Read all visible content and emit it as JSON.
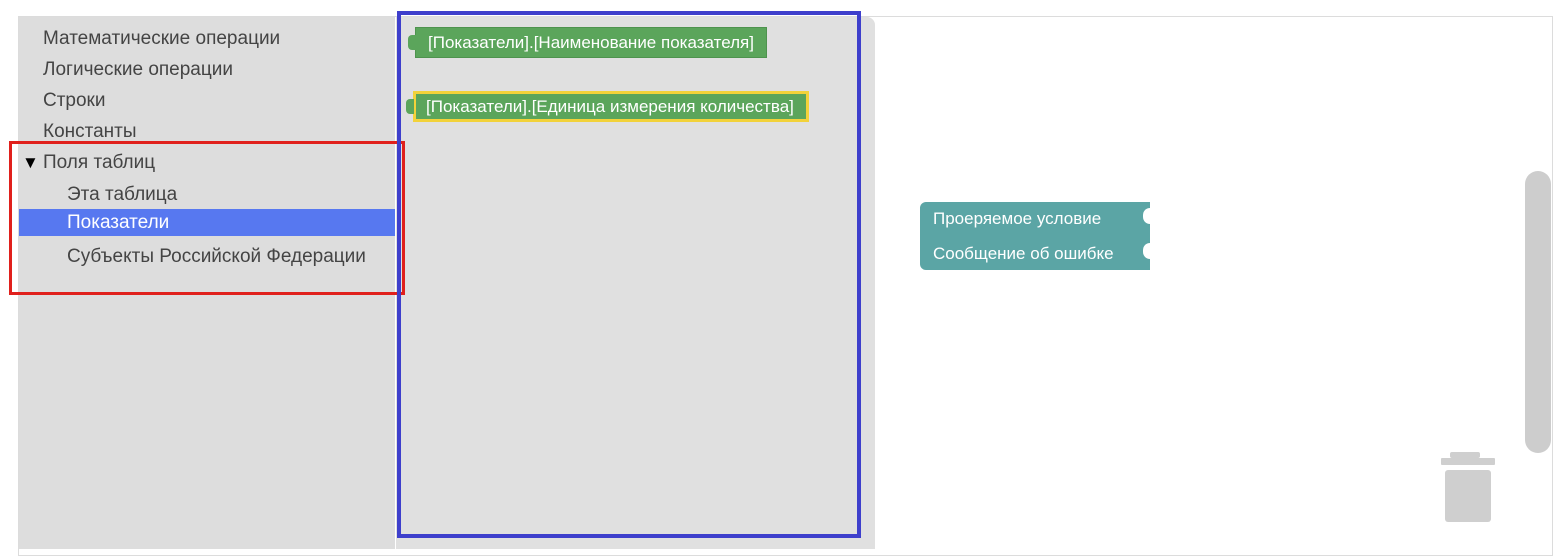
{
  "toolbox": {
    "items": [
      {
        "label": "Математические операции"
      },
      {
        "label": "Логические операции"
      },
      {
        "label": "Строки"
      },
      {
        "label": "Константы"
      },
      {
        "label": "Поля таблиц",
        "expanded_marker": "▼"
      },
      {
        "label": "Эта таблица"
      },
      {
        "label": "Показатели",
        "selected": true
      },
      {
        "label": "Субъекты Российской Федерации"
      }
    ]
  },
  "flyout": {
    "blocks": [
      {
        "label": "[Показатели].[Наименование показателя]",
        "color": "#5ba55b"
      },
      {
        "label": "[Показатели].[Единица измерения количества]",
        "color": "#5ba55b",
        "highlight": "#f2d23a"
      }
    ]
  },
  "canvas": {
    "validation_block": {
      "condition_label": "Проеряемое условие",
      "error_label": "Сообщение об ошибке",
      "color": "#5ba5a5"
    },
    "trash_icon": "trash-can-icon"
  },
  "annotations": {
    "red_box_color": "#e0201c",
    "blue_box_color": "#3e3fcc"
  }
}
